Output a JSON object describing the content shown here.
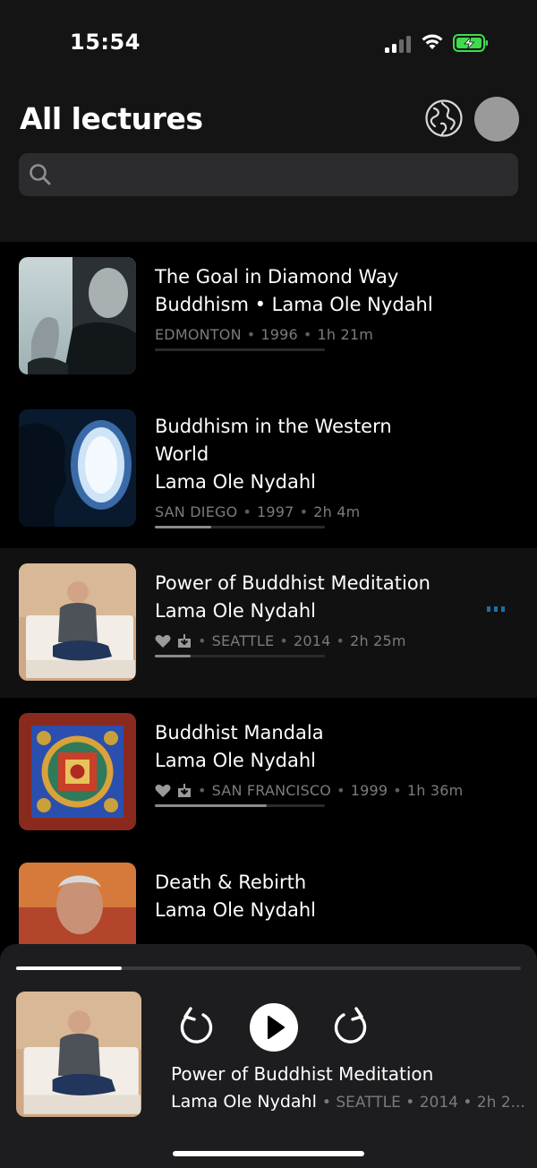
{
  "status_bar": {
    "time": "15:54"
  },
  "header": {
    "title": "All lectures",
    "search_placeholder": ""
  },
  "lectures": [
    {
      "title_line1": "The Goal in Diamond Way",
      "title_line2": "Buddhism • Lama Ole Nydahl",
      "city": "EDMONTON",
      "year": "1996",
      "duration": "1h 21m",
      "progress": 0
    },
    {
      "title_line1": "Buddhism in the Western",
      "title_line2": "World",
      "title_line3": "Lama Ole Nydahl",
      "city": "SAN DIEGO",
      "year": "1997",
      "duration": "2h 4m",
      "progress": 0.33
    },
    {
      "title_line1": "Power of Buddhist Meditation",
      "title_line2": "Lama Ole Nydahl",
      "city": "SEATTLE",
      "year": "2014",
      "duration": "2h 25m",
      "progress": 0.21,
      "favorite": true,
      "downloaded": true,
      "playing": true
    },
    {
      "title_line1": "Buddhist Mandala",
      "title_line2": "Lama Ole Nydahl",
      "city": "SAN FRANCISCO",
      "year": "1999",
      "duration": "1h 36m",
      "progress": 0.66,
      "favorite": true,
      "downloaded": true
    },
    {
      "title_line1": "Death & Rebirth",
      "title_line2": "Lama Ole Nydahl"
    }
  ],
  "player": {
    "title": "Power of Buddhist Meditation",
    "author": "Lama Ole Nydahl",
    "meta": "• SEATTLE • 2014 • 2h 2...",
    "progress": 0.21
  },
  "icons": {
    "globe": "globe-icon",
    "search": "search-icon",
    "heart": "heart-icon",
    "download": "download-icon",
    "rewind": "rewind-15-icon",
    "play": "play-icon",
    "forward": "forward-15-icon"
  },
  "colors": {
    "background": "#000000",
    "header": "#141414",
    "search": "#2c2c2e",
    "player": "#1d1d1f",
    "battery_green": "#3ddc4f",
    "playing_blue": "#1f6fa8"
  }
}
